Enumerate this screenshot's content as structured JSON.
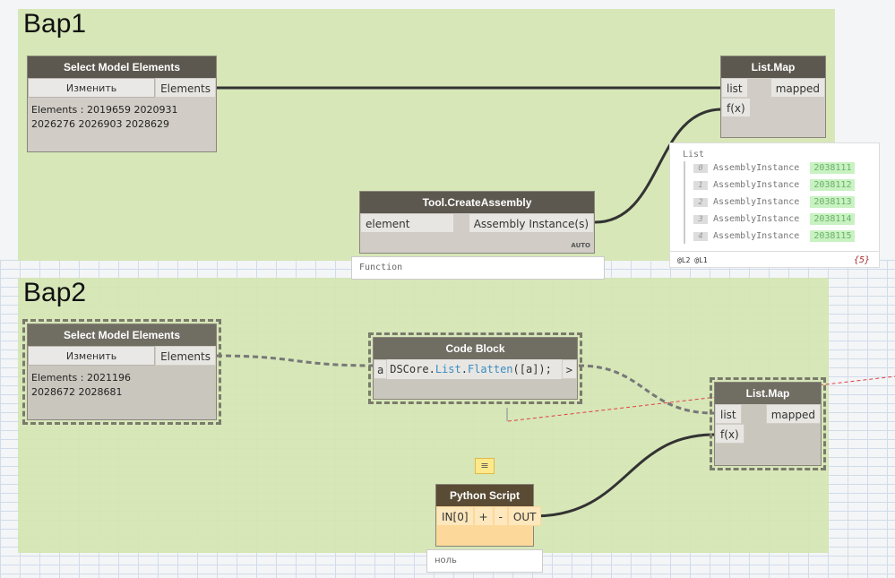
{
  "groups": [
    {
      "title": "Вар1"
    },
    {
      "title": "Вар2"
    }
  ],
  "var1": {
    "select": {
      "title": "Select Model Elements",
      "button": "Изменить",
      "output": "Elements",
      "text": "Elements : 2019659 2020931 2026276 2026903 2028629"
    },
    "listmap": {
      "title": "List.Map",
      "in1": "list",
      "in2": "f(x)",
      "out": "mapped"
    },
    "assembly": {
      "title": "Tool.CreateAssembly",
      "in": "element",
      "out": "Assembly Instance(s)",
      "lacing": "AUTO",
      "preview": "Function"
    },
    "watch": {
      "header": "List",
      "items": [
        {
          "i": "0",
          "type": "AssemblyInstance",
          "id": "2038111"
        },
        {
          "i": "1",
          "type": "AssemblyInstance",
          "id": "2038112"
        },
        {
          "i": "2",
          "type": "AssemblyInstance",
          "id": "2038113"
        },
        {
          "i": "3",
          "type": "AssemblyInstance",
          "id": "2038114"
        },
        {
          "i": "4",
          "type": "AssemblyInstance",
          "id": "2038115"
        }
      ],
      "levels": "@L2 @L1",
      "count": "{5}"
    }
  },
  "var2": {
    "select": {
      "title": "Select Model Elements",
      "button": "Изменить",
      "output": "Elements",
      "text": "Elements : 2021196 2028672 2028681"
    },
    "code": {
      "title": "Code Block",
      "in": "a",
      "code_pre": "DSCore.",
      "code_list": "List",
      "code_dot": ".",
      "code_fn": "Flatten",
      "code_post": "([a]);",
      "out": ">"
    },
    "listmap": {
      "title": "List.Map",
      "in1": "list",
      "in2": "f(x)",
      "out": "mapped"
    },
    "python": {
      "title": "Python Script",
      "in": "IN[0]",
      "plus": "+",
      "minus": "-",
      "out": "OUT",
      "preview": "ноль"
    }
  },
  "colors": {
    "group": "#d4e5b0",
    "node_header": "#5c584f",
    "python_body": "#fcd99a",
    "python_header": "#5a4c34",
    "id_badge": "#c9f2c2"
  }
}
